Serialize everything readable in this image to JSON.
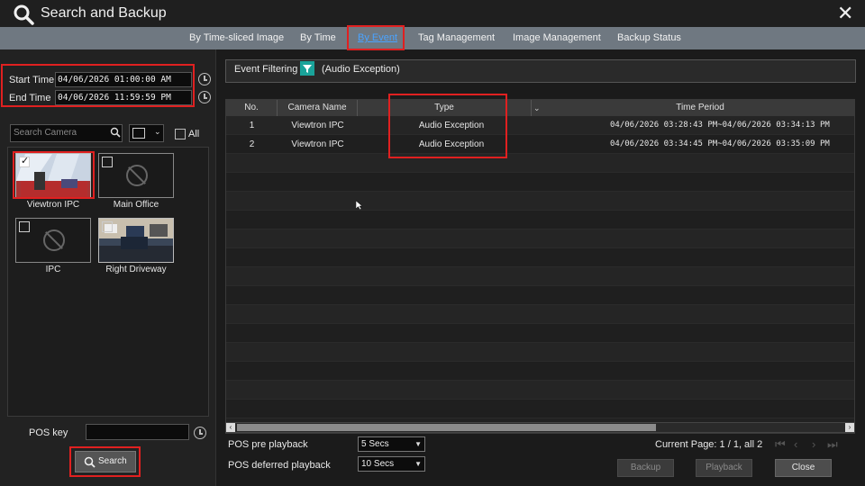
{
  "window": {
    "title": "Search and Backup"
  },
  "tabs": [
    {
      "label": "By Time-sliced Image",
      "active": false
    },
    {
      "label": "By Time",
      "active": false
    },
    {
      "label": "By Event",
      "active": true
    },
    {
      "label": "Tag Management",
      "active": false
    },
    {
      "label": "Image Management",
      "active": false
    },
    {
      "label": "Backup Status",
      "active": false
    }
  ],
  "left": {
    "start_time_label": "Start Time",
    "start_time_value": "04/06/2026 01:00:00 AM",
    "end_time_label": "End Time",
    "end_time_value": "04/06/2026 11:59:59 PM",
    "search_camera_placeholder": "Search Camera",
    "all_label": "All",
    "cameras": [
      {
        "name": "Viewtron IPC",
        "checked": true,
        "has_image": true
      },
      {
        "name": "Main Office",
        "checked": false,
        "has_image": false
      },
      {
        "name": "IPC",
        "checked": false,
        "has_image": false
      },
      {
        "name": "Right Driveway",
        "checked": false,
        "has_image": true
      }
    ],
    "pos_key_label": "POS key",
    "pos_key_value": "",
    "search_button": "Search"
  },
  "filter": {
    "label": "Event Filtering",
    "value": "(Audio Exception)",
    "icon": "filter-icon"
  },
  "table": {
    "headers": [
      "No.",
      "Camera Name",
      "Type",
      "Time Period"
    ],
    "rows": [
      {
        "no": "1",
        "camera": "Viewtron IPC",
        "type": "Audio Exception",
        "period": "04/06/2026 03:28:43 PM~04/06/2026 03:34:13 PM"
      },
      {
        "no": "2",
        "camera": "Viewtron IPC",
        "type": "Audio Exception",
        "period": "04/06/2026 03:34:45 PM~04/06/2026 03:35:09 PM"
      }
    ]
  },
  "playback": {
    "pre_label": "POS pre playback",
    "pre_value": "5 Secs",
    "deferred_label": "POS deferred playback",
    "deferred_value": "10 Secs"
  },
  "pagination": {
    "text": "Current Page: 1 / 1, all 2"
  },
  "buttons": {
    "backup": "Backup",
    "playback": "Playback",
    "close": "Close"
  },
  "colors": {
    "highlight": "#e02020",
    "accent": "#4aa3ff",
    "filter_button": "#1aa39a"
  }
}
